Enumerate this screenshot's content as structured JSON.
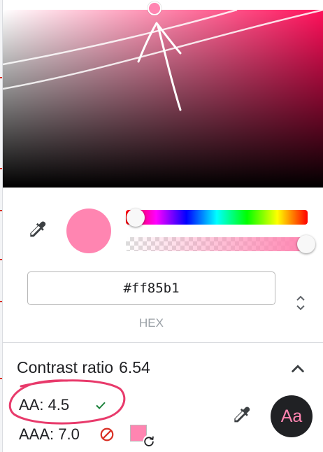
{
  "color_picker": {
    "hex_value": "#ff85b1",
    "format_label": "HEX",
    "current_color": "#ff85b1",
    "hue_color": "#ff0f5a",
    "alpha_percent": 100
  },
  "contrast": {
    "title": "Contrast ratio",
    "ratio": "6.54",
    "aa_label": "AA: 4.5",
    "aaa_label": "AAA: 7.0",
    "aa_status": "pass",
    "aaa_status": "fail",
    "preview_text": "Aa",
    "preview_background": "#202124"
  },
  "icons": {
    "eyedropper": "eyedropper-icon",
    "format_toggle": "chevron-up-down-icon",
    "collapse": "chevron-up-icon",
    "pass": "check-icon",
    "fail": "no-entry-icon",
    "refresh": "refresh-icon"
  },
  "annotation_color": "#e83a6b",
  "pass_color": "#188038",
  "fail_color": "#d93025"
}
